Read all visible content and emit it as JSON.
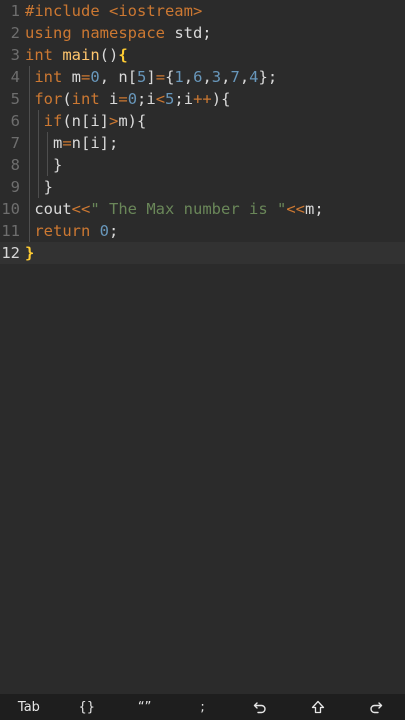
{
  "editor": {
    "current_line": 12,
    "lines": [
      {
        "num": "1",
        "tokens": [
          {
            "t": "#include <iostream>",
            "c": "kw"
          }
        ]
      },
      {
        "num": "2",
        "tokens": [
          {
            "t": "using namespace ",
            "c": "kw"
          },
          {
            "t": "std;",
            "c": "plain"
          }
        ]
      },
      {
        "num": "3",
        "tokens": [
          {
            "t": "int ",
            "c": "kw"
          },
          {
            "t": "main",
            "c": "fn"
          },
          {
            "t": "()",
            "c": "plain"
          },
          {
            "t": "{",
            "c": "br"
          }
        ]
      },
      {
        "num": "4",
        "tokens": [
          {
            "t": " int ",
            "c": "kw"
          },
          {
            "t": "m",
            "c": "plain"
          },
          {
            "t": "=",
            "c": "ops"
          },
          {
            "t": "0",
            "c": "num"
          },
          {
            "t": ", n[",
            "c": "plain"
          },
          {
            "t": "5",
            "c": "num"
          },
          {
            "t": "]",
            "c": "plain"
          },
          {
            "t": "=",
            "c": "ops"
          },
          {
            "t": "{",
            "c": "plain"
          },
          {
            "t": "1",
            "c": "num"
          },
          {
            "t": ",",
            "c": "plain"
          },
          {
            "t": "6",
            "c": "num"
          },
          {
            "t": ",",
            "c": "plain"
          },
          {
            "t": "3",
            "c": "num"
          },
          {
            "t": ",",
            "c": "plain"
          },
          {
            "t": "7",
            "c": "num"
          },
          {
            "t": ",",
            "c": "plain"
          },
          {
            "t": "4",
            "c": "num"
          },
          {
            "t": "};",
            "c": "plain"
          }
        ]
      },
      {
        "num": "5",
        "tokens": [
          {
            "t": " for",
            "c": "kw"
          },
          {
            "t": "(",
            "c": "plain"
          },
          {
            "t": "int ",
            "c": "kw"
          },
          {
            "t": "i",
            "c": "plain"
          },
          {
            "t": "=",
            "c": "ops"
          },
          {
            "t": "0",
            "c": "num"
          },
          {
            "t": ";i",
            "c": "plain"
          },
          {
            "t": "<",
            "c": "ops"
          },
          {
            "t": "5",
            "c": "num"
          },
          {
            "t": ";i",
            "c": "plain"
          },
          {
            "t": "++",
            "c": "ops"
          },
          {
            "t": "){",
            "c": "plain"
          }
        ]
      },
      {
        "num": "6",
        "tokens": [
          {
            "t": "  if",
            "c": "kw"
          },
          {
            "t": "(n[i]",
            "c": "plain"
          },
          {
            "t": ">",
            "c": "ops"
          },
          {
            "t": "m){",
            "c": "plain"
          }
        ]
      },
      {
        "num": "7",
        "tokens": [
          {
            "t": "   m",
            "c": "plain"
          },
          {
            "t": "=",
            "c": "ops"
          },
          {
            "t": "n[i];",
            "c": "plain"
          }
        ]
      },
      {
        "num": "8",
        "tokens": [
          {
            "t": "   }",
            "c": "plain"
          }
        ]
      },
      {
        "num": "9",
        "tokens": [
          {
            "t": "  }",
            "c": "plain"
          }
        ]
      },
      {
        "num": "10",
        "tokens": [
          {
            "t": " cout",
            "c": "plain"
          },
          {
            "t": "<<",
            "c": "ops"
          },
          {
            "t": "\" The Max number is \"",
            "c": "str"
          },
          {
            "t": "<<",
            "c": "ops"
          },
          {
            "t": "m;",
            "c": "plain"
          }
        ]
      },
      {
        "num": "11",
        "tokens": [
          {
            "t": " return ",
            "c": "kw"
          },
          {
            "t": "0",
            "c": "num"
          },
          {
            "t": ";",
            "c": "plain"
          }
        ]
      },
      {
        "num": "12",
        "tokens": [
          {
            "t": "}",
            "c": "br"
          }
        ]
      }
    ]
  },
  "keybar": {
    "keys": [
      {
        "label": "Tab",
        "name": "tab-key"
      },
      {
        "label": "{}",
        "name": "braces-key"
      },
      {
        "label": "“”",
        "name": "quotes-key"
      },
      {
        "label": ";",
        "name": "semicolon-key"
      },
      {
        "label": "",
        "icon": "undo-icon",
        "name": "undo-key"
      },
      {
        "label": "",
        "icon": "shift-up-icon",
        "name": "shift-key"
      },
      {
        "label": "",
        "icon": "redo-icon",
        "name": "redo-key"
      }
    ]
  },
  "colors": {
    "background": "#2b2b2b",
    "keyword": "#cc7832",
    "function": "#ffc66d",
    "number": "#6897bb",
    "string": "#6a8759",
    "bracket_match": "#ffcc33"
  }
}
